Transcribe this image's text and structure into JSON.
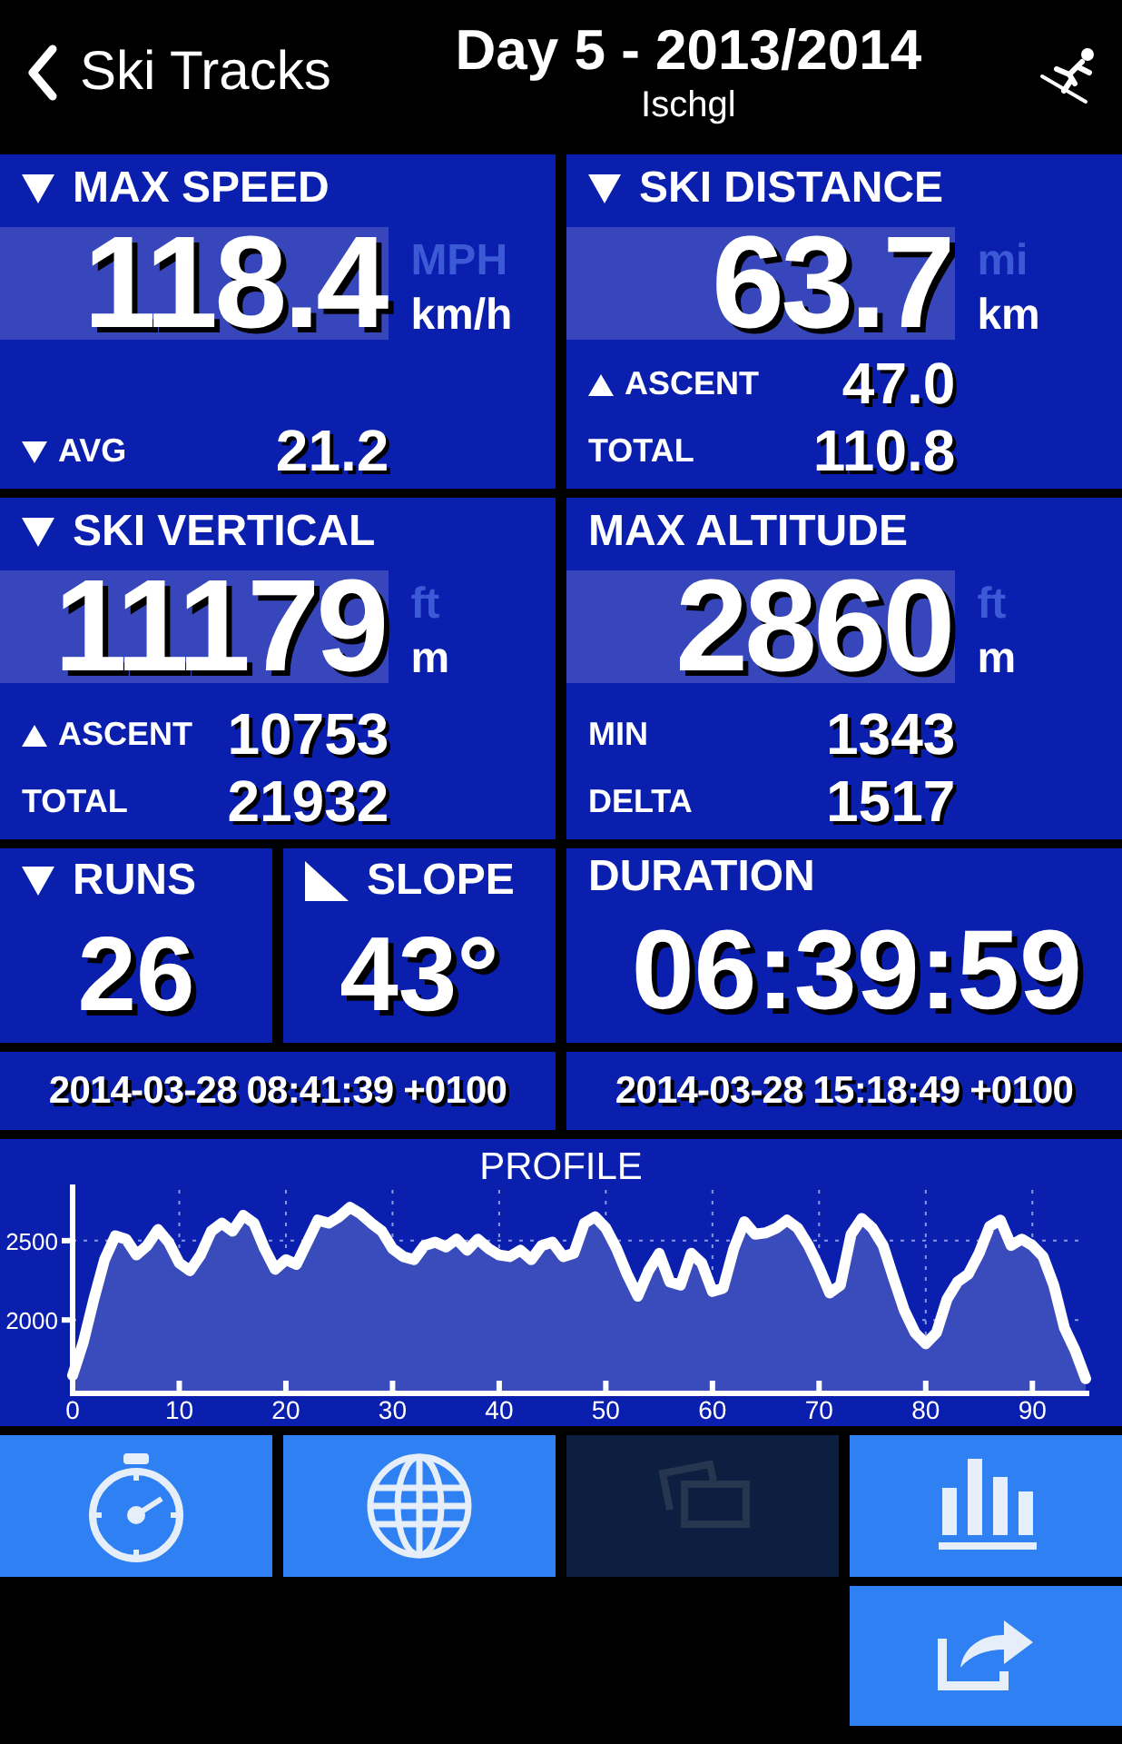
{
  "header": {
    "back": {
      "label": "Ski Tracks"
    },
    "title": "Day 5 - 2013/2014",
    "subtitle": "Ischgl"
  },
  "tiles": [
    {
      "kind": "main",
      "dropdown": true,
      "title": "MAX SPEED",
      "value": "118.4",
      "units": [
        {
          "label": "MPH",
          "selected": false
        },
        {
          "label": "km/h",
          "selected": true
        }
      ],
      "rows": [
        {
          "kind": "average",
          "label": "AVG",
          "value": "21.2"
        }
      ]
    },
    {
      "kind": "main",
      "dropdown": true,
      "title": "SKI DISTANCE",
      "value": "63.7",
      "units": [
        {
          "label": "mi",
          "selected": false
        },
        {
          "label": "km",
          "selected": true
        }
      ],
      "rows": [
        {
          "kind": "ascent",
          "label": "ASCENT",
          "value": "47.0"
        },
        {
          "kind": "plain",
          "label": "TOTAL",
          "value": "110.8"
        }
      ]
    },
    {
      "kind": "main",
      "dropdown": true,
      "title": "SKI VERTICAL",
      "value": "11179",
      "units": [
        {
          "label": "ft",
          "selected": false
        },
        {
          "label": "m",
          "selected": true
        }
      ],
      "rows": [
        {
          "kind": "ascent",
          "label": "ASCENT",
          "value": "10753"
        },
        {
          "kind": "plain",
          "label": "TOTAL",
          "value": "21932"
        }
      ]
    },
    {
      "kind": "main",
      "dropdown": false,
      "title": "MAX ALTITUDE",
      "value": "2860",
      "units": [
        {
          "label": "ft",
          "selected": false
        },
        {
          "label": "m",
          "selected": true
        }
      ],
      "rows": [
        {
          "kind": "plain",
          "label": "MIN",
          "value": "1343"
        },
        {
          "kind": "plain",
          "label": "DELTA",
          "value": "1517"
        }
      ]
    },
    {
      "kind": "stat",
      "dropdown": true,
      "title": "RUNS",
      "value": "26"
    },
    {
      "kind": "angle",
      "dropdown": false,
      "title": "SLOPE",
      "value": "43°"
    },
    {
      "kind": "wide",
      "dropdown": false,
      "title": "DURATION",
      "value": "06:39:59"
    }
  ],
  "times": [
    "2014-03-28 08:41:39 +0100",
    "2014-03-28 15:18:49 +0100"
  ],
  "profile": {
    "chart_data": {
      "type": "area",
      "title": "PROFILE",
      "grid": true,
      "x": [
        0,
        1,
        2,
        3,
        4,
        5,
        6,
        7,
        8,
        9,
        10,
        11,
        12,
        13,
        14,
        15,
        16,
        17,
        18,
        19,
        20,
        21,
        22,
        23,
        24,
        25,
        26,
        27,
        28,
        29,
        30,
        31,
        32,
        33,
        34,
        35,
        36,
        37,
        38,
        39,
        40,
        41,
        42,
        43,
        44,
        45,
        46,
        47,
        48,
        49,
        50,
        51,
        52,
        53,
        54,
        55,
        56,
        57,
        58,
        59,
        60,
        61,
        62,
        63,
        64,
        65,
        66,
        67,
        68,
        69,
        70,
        71,
        72,
        73,
        74,
        75,
        76,
        77,
        78,
        79,
        80,
        81,
        82,
        83,
        84,
        85,
        86,
        87,
        88,
        89,
        90,
        91,
        92,
        93,
        94,
        95
      ],
      "series": [
        {
          "color": "#ffffff",
          "values": [
            1650,
            1860,
            2130,
            2380,
            2530,
            2510,
            2410,
            2470,
            2570,
            2490,
            2360,
            2310,
            2410,
            2560,
            2610,
            2560,
            2660,
            2610,
            2450,
            2320,
            2380,
            2350,
            2490,
            2630,
            2610,
            2650,
            2710,
            2670,
            2610,
            2560,
            2450,
            2400,
            2380,
            2470,
            2490,
            2460,
            2510,
            2440,
            2510,
            2450,
            2410,
            2400,
            2440,
            2380,
            2470,
            2490,
            2400,
            2420,
            2610,
            2650,
            2580,
            2450,
            2290,
            2150,
            2310,
            2420,
            2240,
            2220,
            2420,
            2360,
            2180,
            2200,
            2450,
            2620,
            2540,
            2550,
            2580,
            2630,
            2580,
            2470,
            2330,
            2170,
            2220,
            2540,
            2640,
            2580,
            2470,
            2260,
            2060,
            1920,
            1850,
            1920,
            2130,
            2240,
            2290,
            2420,
            2590,
            2630,
            2470,
            2510,
            2470,
            2400,
            2220,
            1950,
            1810,
            1630
          ]
        }
      ],
      "xlim": [
        0,
        95
      ],
      "ylim": [
        1560,
        2820
      ],
      "xticks": [
        0,
        10,
        20,
        30,
        40,
        50,
        60,
        70,
        80,
        90
      ],
      "yticks": [
        2000,
        2500
      ]
    }
  },
  "button_rows": [
    [
      {
        "kind": "stopwatch",
        "disabled": false
      },
      {
        "kind": "globe",
        "disabled": false
      },
      {
        "kind": "cards",
        "disabled": true
      },
      {
        "kind": "bars",
        "disabled": false
      }
    ],
    [
      {
        "kind": "share",
        "disabled": false
      }
    ]
  ]
}
